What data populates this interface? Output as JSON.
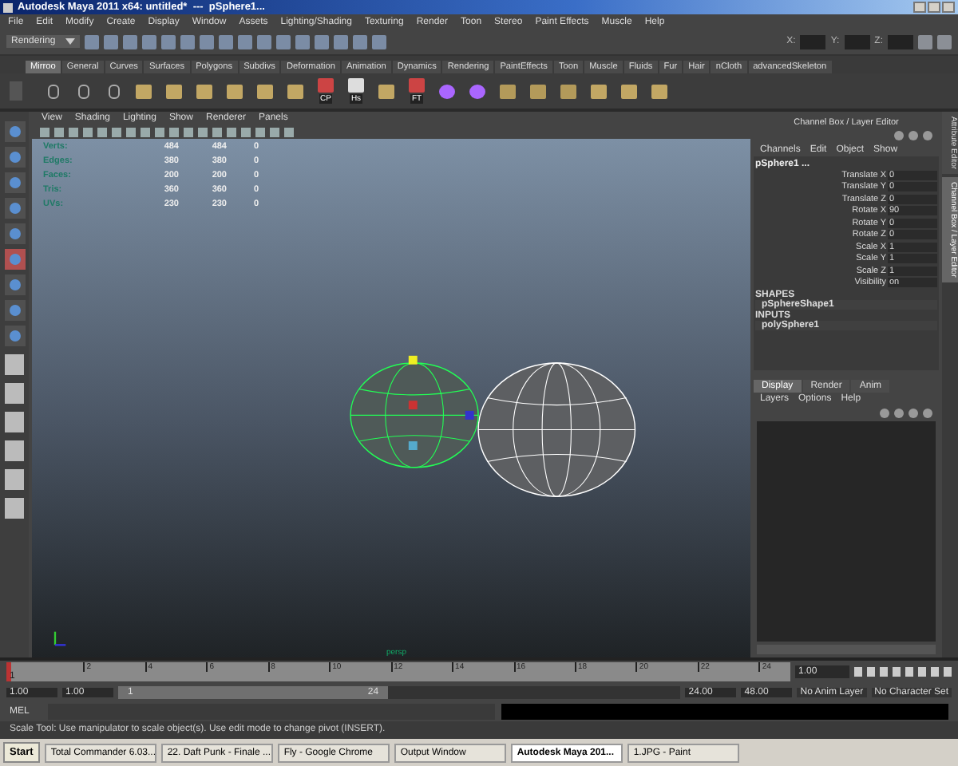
{
  "window": {
    "title": "Autodesk Maya 2011 x64: untitled*  ---  pSphere1..."
  },
  "menu_bar": [
    "File",
    "Edit",
    "Modify",
    "Create",
    "Display",
    "Window",
    "Assets",
    "Lighting/Shading",
    "Texturing",
    "Render",
    "Toon",
    "Stereo",
    "Paint Effects",
    "Muscle",
    "Help"
  ],
  "status_line": {
    "mode_menu": "Rendering",
    "fields": [
      {
        "label": "X:"
      },
      {
        "label": "Y:"
      },
      {
        "label": "Z:"
      }
    ]
  },
  "shelf": {
    "tabs": [
      {
        "label": "Mirroo",
        "selected": true
      },
      {
        "label": "General",
        "selected": false
      },
      {
        "label": "Curves",
        "selected": false
      },
      {
        "label": "Surfaces",
        "selected": false
      },
      {
        "label": "Polygons",
        "selected": false
      },
      {
        "label": "Subdivs",
        "selected": false
      },
      {
        "label": "Deformation",
        "selected": false
      },
      {
        "label": "Animation",
        "selected": false
      },
      {
        "label": "Dynamics",
        "selected": false
      },
      {
        "label": "Rendering",
        "selected": false
      },
      {
        "label": "PaintEffects",
        "selected": false
      },
      {
        "label": "Toon",
        "selected": false
      },
      {
        "label": "Muscle",
        "selected": false
      },
      {
        "label": "Fluids",
        "selected": false
      },
      {
        "label": "Fur",
        "selected": false
      },
      {
        "label": "Hair",
        "selected": false
      },
      {
        "label": "nCloth",
        "selected": false
      },
      {
        "label": "advancedSkeleton",
        "selected": false
      }
    ],
    "buttons": [
      {
        "kind": "script"
      },
      {
        "kind": "script"
      },
      {
        "kind": "script"
      },
      {
        "kind": "mesh"
      },
      {
        "kind": "mesh"
      },
      {
        "kind": "mesh"
      },
      {
        "kind": "mesh"
      },
      {
        "kind": "mesh"
      },
      {
        "kind": "mesh"
      },
      {
        "kind": "axis",
        "label": "CP"
      },
      {
        "kind": "note",
        "label": "Hs"
      },
      {
        "kind": "mesh"
      },
      {
        "kind": "axis",
        "label": "FT"
      },
      {
        "kind": "sphere"
      },
      {
        "kind": "sphere"
      },
      {
        "kind": "box"
      },
      {
        "kind": "box"
      },
      {
        "kind": "box"
      },
      {
        "kind": "mesh"
      },
      {
        "kind": "mesh"
      },
      {
        "kind": "mesh"
      }
    ]
  },
  "toolbox": {
    "tools": [
      {
        "selected": false
      },
      {
        "selected": false
      },
      {
        "selected": false
      },
      {
        "selected": false
      },
      {
        "selected": false
      },
      {
        "selected": true
      },
      {
        "selected": false
      },
      {
        "selected": false
      },
      {
        "selected": false
      }
    ]
  },
  "viewport": {
    "menus": [
      "View",
      "Shading",
      "Lighting",
      "Show",
      "Renderer",
      "Panels"
    ],
    "hud": [
      {
        "label": "Verts:",
        "values": [
          "484",
          "484",
          "0"
        ]
      },
      {
        "label": "Edges:",
        "values": [
          "380",
          "380",
          "0"
        ]
      },
      {
        "label": "Faces:",
        "values": [
          "200",
          "200",
          "0"
        ]
      },
      {
        "label": "Tris:",
        "values": [
          "360",
          "360",
          "0"
        ]
      },
      {
        "label": "UVs:",
        "values": [
          "230",
          "230",
          "0"
        ]
      }
    ],
    "camera": "persp"
  },
  "channel_box": {
    "title": "Channel Box / Layer Editor",
    "menus": [
      "Channels",
      "Edit",
      "Object",
      "Show"
    ],
    "object": "pSphere1 ...",
    "attributes": [
      {
        "name": "Translate X",
        "value": "0"
      },
      {
        "name": "Translate Y",
        "value": "0"
      },
      {
        "name": "Translate Z",
        "value": "0"
      },
      {
        "name": "Rotate X",
        "value": "90"
      },
      {
        "name": "Rotate Y",
        "value": "0"
      },
      {
        "name": "Rotate Z",
        "value": "0"
      },
      {
        "name": "Scale X",
        "value": "1"
      },
      {
        "name": "Scale Y",
        "value": "1"
      },
      {
        "name": "Scale Z",
        "value": "1"
      },
      {
        "name": "Visibility",
        "value": "on"
      }
    ],
    "shapes_heading": "SHAPES",
    "shape": "pSphereShape1",
    "inputs_heading": "INPUTS",
    "input": "polySphere1"
  },
  "layer_editor": {
    "tabs": [
      {
        "label": "Display",
        "selected": true
      },
      {
        "label": "Render",
        "selected": false
      },
      {
        "label": "Anim",
        "selected": false
      }
    ],
    "menus": [
      "Layers",
      "Options",
      "Help"
    ]
  },
  "side_tabs": [
    {
      "label": "Attribute Editor",
      "selected": false
    },
    {
      "label": "Channel Box / Layer Editor",
      "selected": true
    }
  ],
  "time_slider": {
    "ticks": [
      "2",
      "4",
      "6",
      "8",
      "10",
      "12",
      "14",
      "16",
      "18",
      "20",
      "22",
      "24"
    ],
    "start_label": "1",
    "current_time": "1.00",
    "level": 0
  },
  "range_slider": {
    "start": "1.00",
    "playback_start": "1.00",
    "handle_start": "1",
    "handle_end": "24",
    "level": 0.48,
    "playback_end": "24.00",
    "end": "48.00",
    "anim_layer": "No Anim Layer",
    "character_set": "No Character Set"
  },
  "command_line": {
    "label": "MEL"
  },
  "help_line": "Scale Tool: Use manipulator to scale object(s). Use edit mode to change pivot (INSERT).",
  "taskbar": {
    "start": "Start",
    "tasks": [
      {
        "label": "Total Commander 6.03...",
        "selected": false
      },
      {
        "label": "22. Daft Punk - Finale ...",
        "selected": false
      },
      {
        "label": "Fly - Google Chrome",
        "selected": false
      },
      {
        "label": "Output Window",
        "selected": false
      },
      {
        "label": "Autodesk Maya 201...",
        "selected": true
      },
      {
        "label": "1.JPG - Paint",
        "selected": false
      }
    ]
  }
}
